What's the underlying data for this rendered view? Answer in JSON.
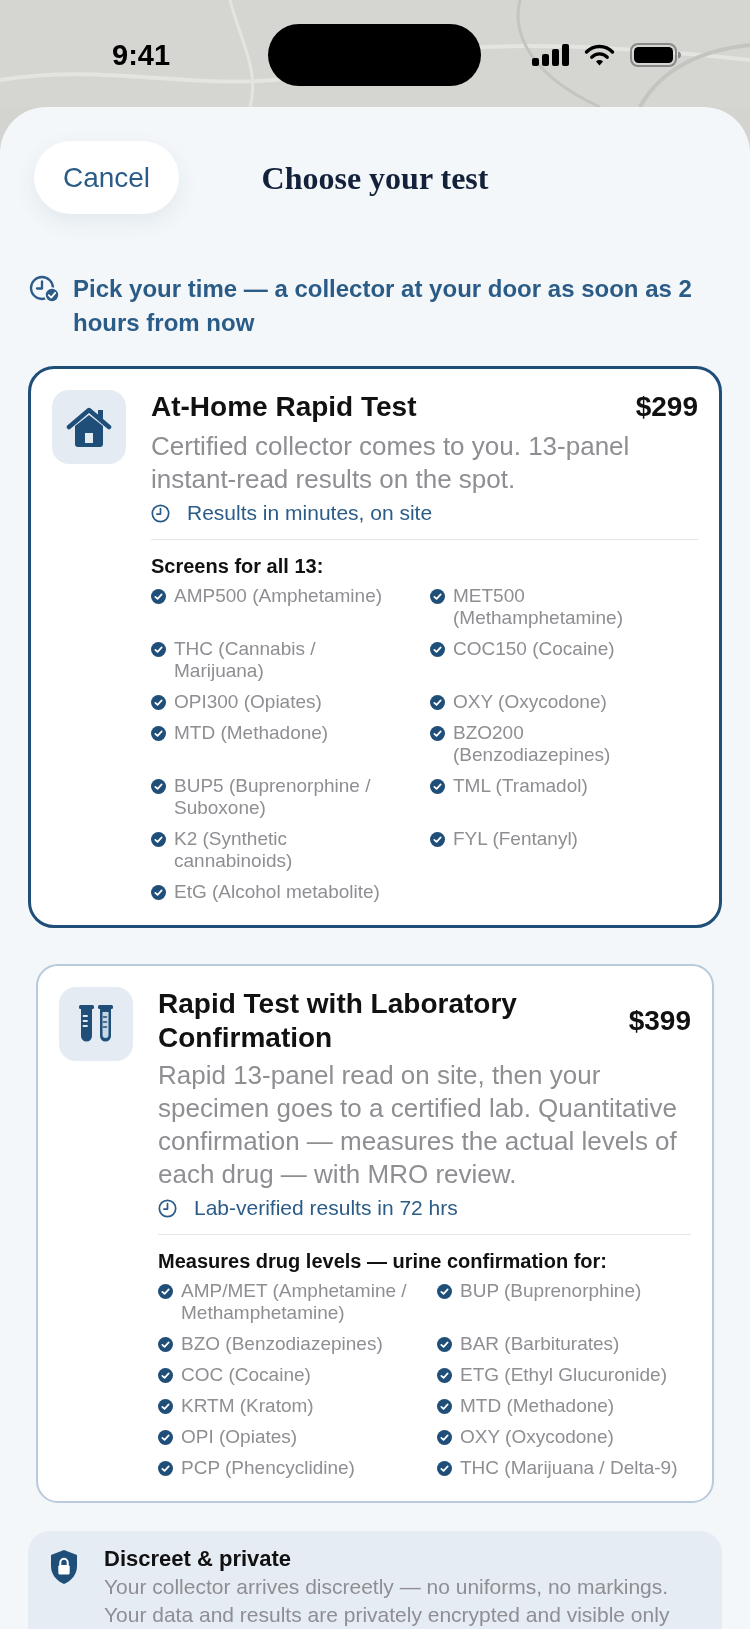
{
  "status_bar": {
    "time": "9:41"
  },
  "header": {
    "cancel": "Cancel",
    "title": "Choose your test"
  },
  "notice": {
    "text": "Pick your time — a collector at your door as soon as 2 hours from now"
  },
  "options": [
    {
      "kind": "home",
      "selected": true,
      "title": "At-Home Rapid Test",
      "price": "$299",
      "description": "Certified collector comes to you. 13-panel instant-read results on the spot.",
      "timing": "Results in minutes, on site",
      "list_heading": "Screens for all 13:",
      "items": [
        "AMP500 (Amphetamine)",
        "MET500 (Methamphetamine)",
        "THC (Cannabis / Marijuana)",
        "COC150 (Cocaine)",
        "OPI300 (Opiates)",
        "OXY (Oxycodone)",
        "MTD (Methadone)",
        "BZO200 (Benzodiazepines)",
        "BUP5 (Buprenorphine / Suboxone)",
        "TML (Tramadol)",
        "K2 (Synthetic cannabinoids)",
        "FYL (Fentanyl)",
        "EtG (Alcohol metabolite)"
      ]
    },
    {
      "kind": "lab",
      "selected": false,
      "title": "Rapid Test with Laboratory Confirmation",
      "price": "$399",
      "description": "Rapid 13-panel read on site, then your specimen goes to a certified lab. Quantitative confirmation — measures the actual levels of each drug — with MRO review.",
      "timing": "Lab-verified results in 72 hrs",
      "list_heading": "Measures drug levels — urine confirmation for:",
      "items": [
        "AMP/MET (Amphetamine / Methamphetamine)",
        "BUP (Buprenorphine)",
        "BZO (Benzodiazepines)",
        "BAR (Barbiturates)",
        "COC (Cocaine)",
        "ETG (Ethyl Glucuronide)",
        "KRTM (Kratom)",
        "MTD (Methadone)",
        "OPI (Opiates)",
        "OXY (Oxycodone)",
        "PCP (Phencyclidine)",
        "THC (Marijuana / Delta-9)"
      ]
    }
  ],
  "privacy": {
    "title": "Discreet & private",
    "text": "Your collector arrives discreetly — no uniforms, no markings. Your data and results are privately encrypted and visible only"
  }
}
